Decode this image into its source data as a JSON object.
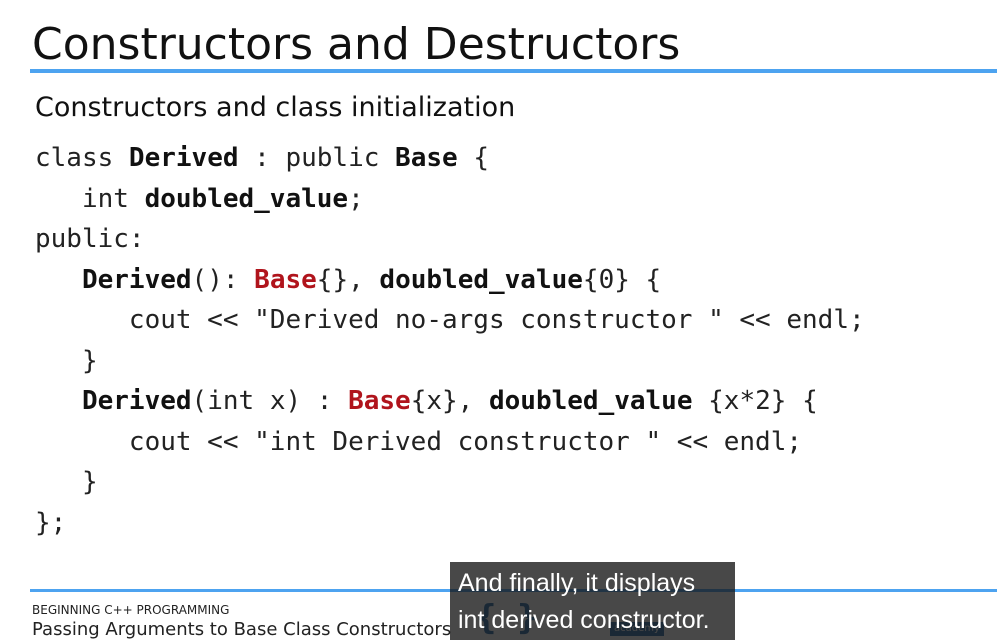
{
  "slide": {
    "title": "Constructors and Destructors",
    "subtitle": "Constructors and class initialization"
  },
  "code": {
    "lines": [
      [
        {
          "t": "class ",
          "s": "n"
        },
        {
          "t": "Derived",
          "s": "b"
        },
        {
          "t": " : public ",
          "s": "n"
        },
        {
          "t": "Base",
          "s": "b"
        },
        {
          "t": " {",
          "s": "n"
        }
      ],
      [
        {
          "t": "   int ",
          "s": "n"
        },
        {
          "t": "doubled_value",
          "s": "b"
        },
        {
          "t": ";",
          "s": "n"
        }
      ],
      [
        {
          "t": "public:",
          "s": "n"
        }
      ],
      [
        {
          "t": "   ",
          "s": "n"
        },
        {
          "t": "Derived",
          "s": "b"
        },
        {
          "t": "(): ",
          "s": "n"
        },
        {
          "t": "Base",
          "s": "r"
        },
        {
          "t": "{}, ",
          "s": "n"
        },
        {
          "t": "doubled_value",
          "s": "b"
        },
        {
          "t": "{0} {",
          "s": "n"
        }
      ],
      [
        {
          "t": "      cout << \"Derived no-args constructor \" << endl;",
          "s": "n"
        }
      ],
      [
        {
          "t": "   }",
          "s": "n"
        }
      ],
      [
        {
          "t": "   ",
          "s": "n"
        },
        {
          "t": "Derived",
          "s": "b"
        },
        {
          "t": "(int x) : ",
          "s": "n"
        },
        {
          "t": "Base",
          "s": "r"
        },
        {
          "t": "{x}, ",
          "s": "n"
        },
        {
          "t": "doubled_value",
          "s": "b"
        },
        {
          "t": " {x*2} {",
          "s": "n"
        }
      ],
      [
        {
          "t": "      cout << \"int Derived constructor \" << endl;",
          "s": "n"
        }
      ],
      [
        {
          "t": "   }",
          "s": "n"
        }
      ],
      [
        {
          "t": "};",
          "s": "n"
        }
      ]
    ]
  },
  "footer": {
    "course": "BEGINNING C++ PROGRAMMING",
    "lecture": "Passing Arguments to Base Class Constructors",
    "logo_braces": "{ }",
    "logo_text": "academy"
  },
  "caption": {
    "line1": "And finally, it displays",
    "line2": "int derived constructor."
  },
  "colors": {
    "accent_rule": "#4da3f0",
    "highlight_red": "#b0141c",
    "logo_blue": "#2f6fa8"
  }
}
